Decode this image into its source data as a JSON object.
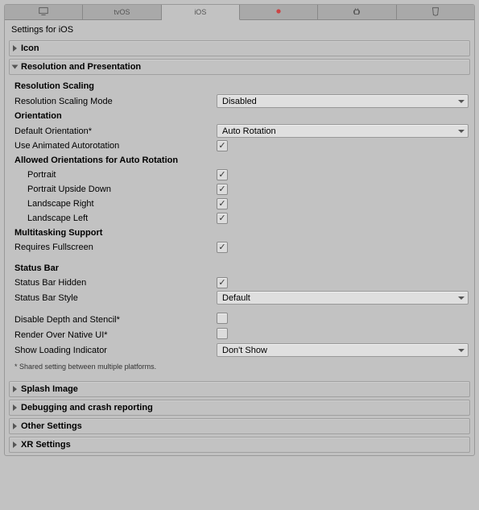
{
  "tabs": {
    "standalone": "",
    "tvos": "tvOS",
    "ios": "iOS",
    "lumin": "",
    "android": "",
    "webgl": ""
  },
  "title": "Settings for iOS",
  "sections": {
    "icon": "Icon",
    "resolution": "Resolution and Presentation",
    "splash": "Splash Image",
    "debugging": "Debugging and crash reporting",
    "other": "Other Settings",
    "xr": "XR Settings"
  },
  "res": {
    "resolution_scaling": "Resolution Scaling",
    "resolution_scaling_mode_label": "Resolution Scaling Mode",
    "resolution_scaling_mode_value": "Disabled",
    "orientation": "Orientation",
    "default_orientation_label": "Default Orientation*",
    "default_orientation_value": "Auto Rotation",
    "use_animated_autorotation": "Use Animated Autorotation",
    "allowed_orientations": "Allowed Orientations for Auto Rotation",
    "portrait": "Portrait",
    "portrait_upside_down": "Portrait Upside Down",
    "landscape_right": "Landscape Right",
    "landscape_left": "Landscape Left",
    "multitasking_support": "Multitasking Support",
    "requires_fullscreen": "Requires Fullscreen",
    "status_bar": "Status Bar",
    "status_bar_hidden": "Status Bar Hidden",
    "status_bar_style_label": "Status Bar Style",
    "status_bar_style_value": "Default",
    "disable_depth_stencil": "Disable Depth and Stencil*",
    "render_over_native_ui": "Render Over Native UI*",
    "show_loading_indicator_label": "Show Loading Indicator",
    "show_loading_indicator_value": "Don't Show",
    "footnote": "* Shared setting between multiple platforms."
  }
}
